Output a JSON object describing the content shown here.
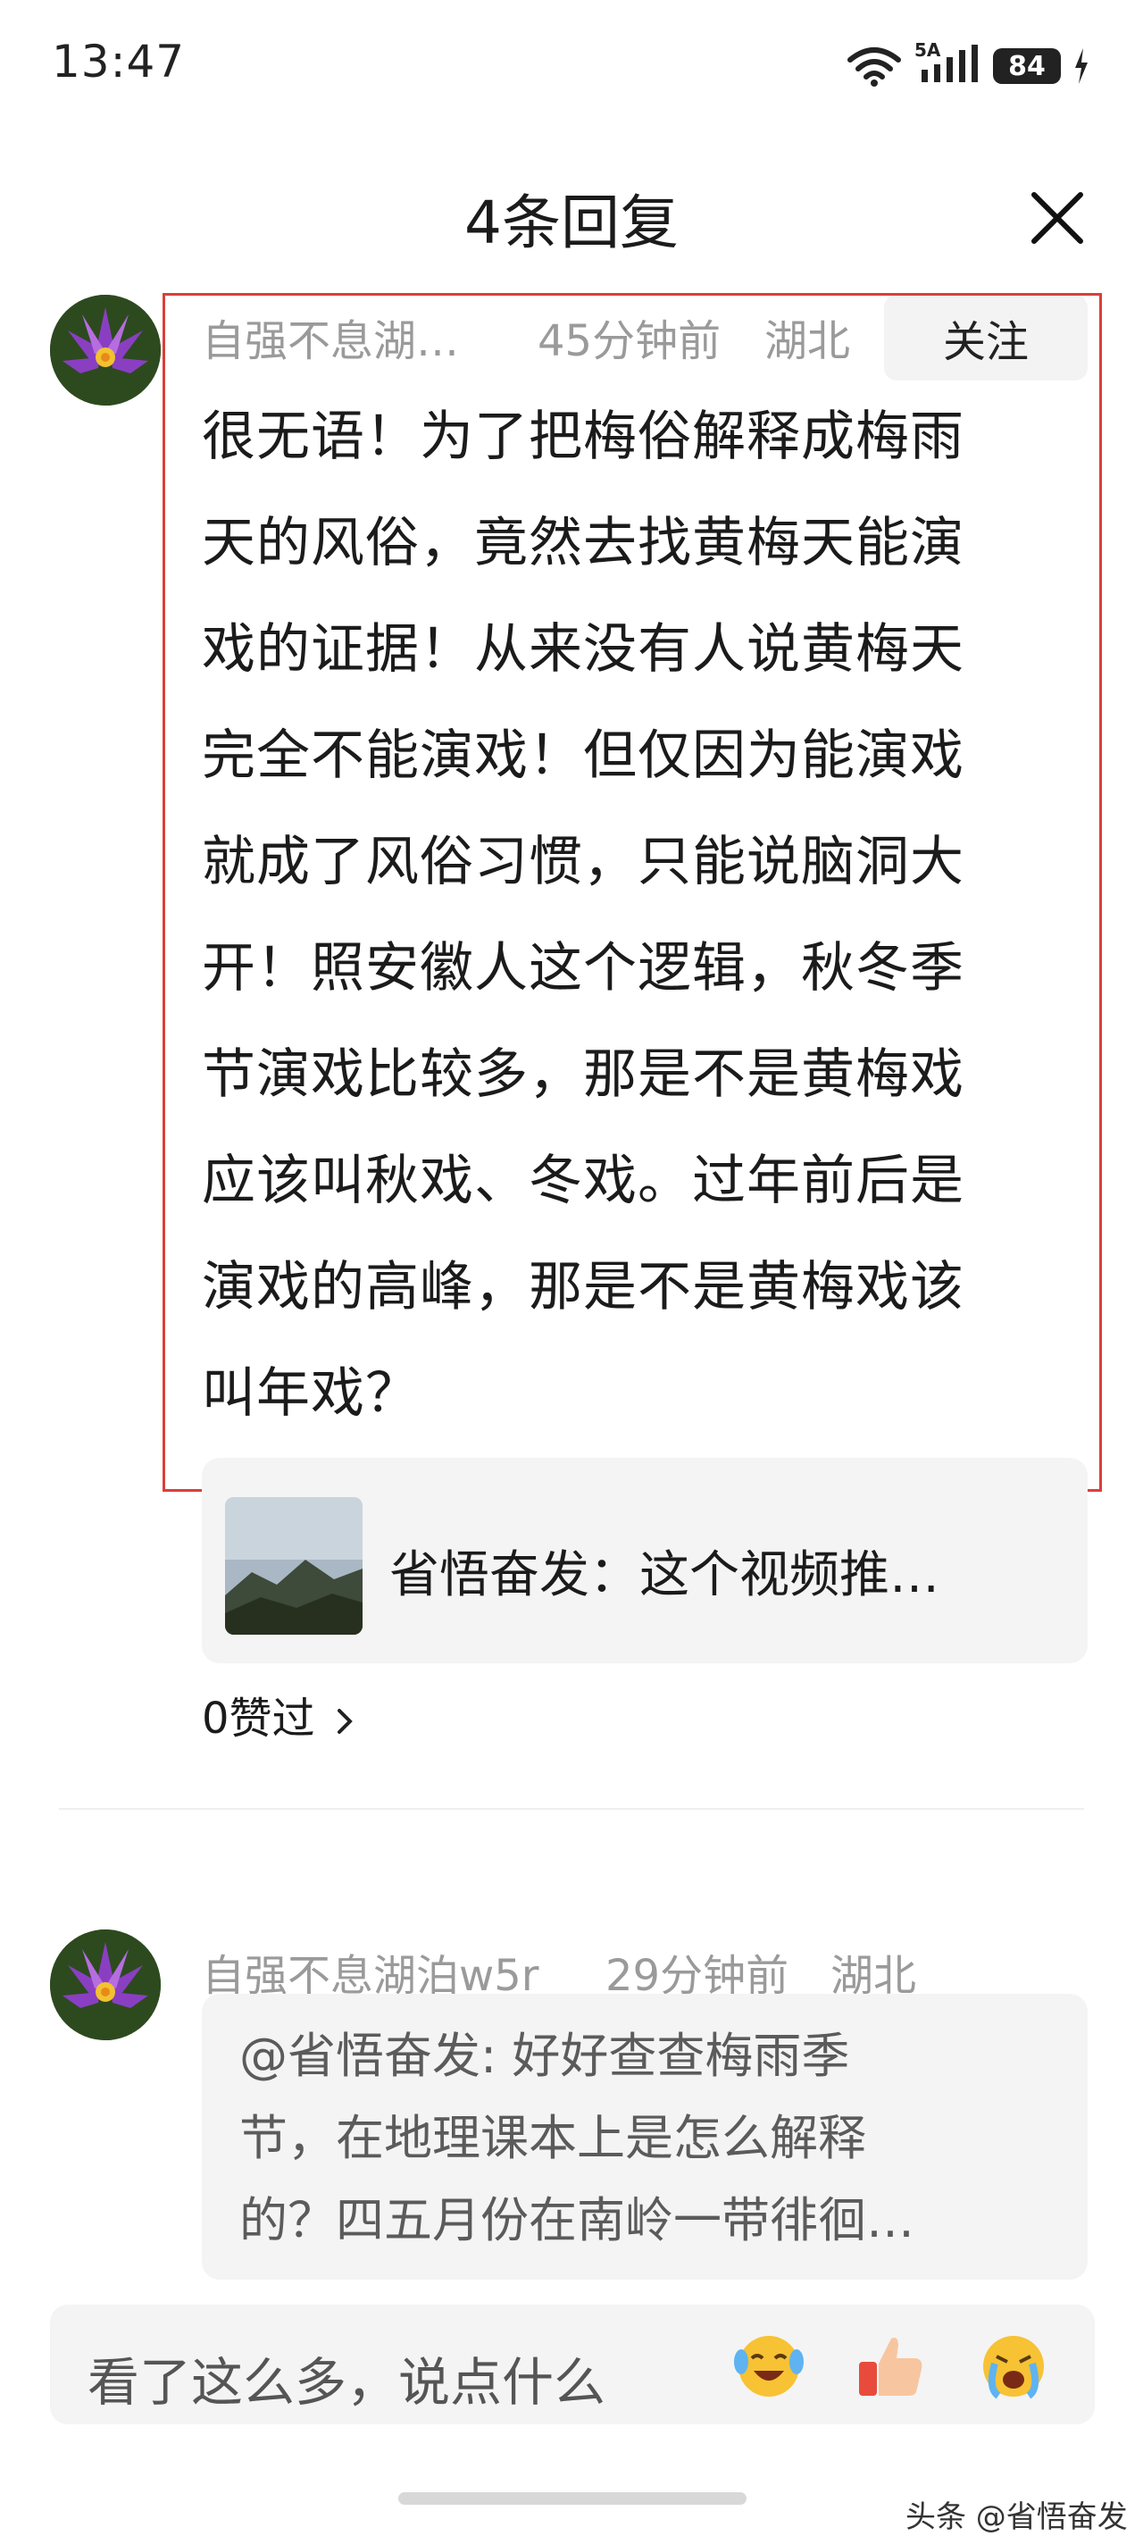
{
  "status_bar": {
    "time": "13:47",
    "network": "5A",
    "battery": "84",
    "icons": [
      "wifi-icon",
      "signal-icon",
      "battery-icon",
      "charging-icon"
    ]
  },
  "header": {
    "title": "4条回复",
    "close_icon": "close-icon"
  },
  "comment": {
    "username": "自强不息湖…",
    "time": "45分钟前",
    "location": "湖北",
    "follow_label": "关注",
    "lines": [
      "很无语！为了把梅俗解释成梅雨",
      "天的风俗，竟然去找黄梅天能演",
      "戏的证据！从来没有人说黄梅天",
      "完全不能演戏！但仅因为能演戏",
      "就成了风俗习惯，只能说脑洞大",
      "开！照安徽人这个逻辑，秋冬季",
      "节演戏比较多，那是不是黄梅戏",
      "应该叫秋戏、冬戏。过年前后是",
      "演戏的高峰，那是不是黄梅戏该",
      "叫年戏？"
    ],
    "referenced_text": "省悟奋发：这个视频推…",
    "likes_label": "0赞过",
    "highlight_color": "#d9403a"
  },
  "reply": {
    "username": "自强不息湖泊w5r",
    "time": "29分钟前",
    "location": "湖北",
    "quote_lines": [
      "@省悟奋发: 好好查查梅雨季",
      "节，在地理课本上是怎么解释",
      "的？四五月份在南岭一带徘徊…"
    ]
  },
  "input": {
    "placeholder": "看了这么多，说点什么",
    "emojis": [
      "laughing-crying-emoji-icon",
      "thumbs-up-emoji-icon",
      "crying-emoji-icon"
    ]
  },
  "watermark": "头条 @省悟奋发"
}
